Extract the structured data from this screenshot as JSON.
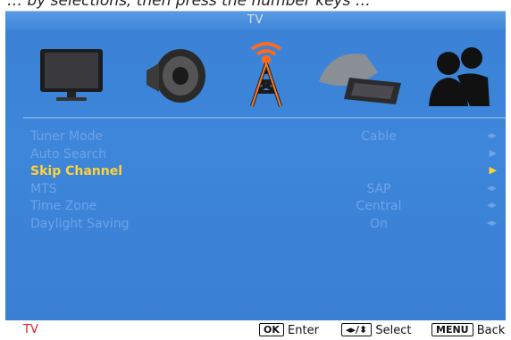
{
  "screen_title": "TV",
  "top_cropped_text": "… by selections, then press the number keys …",
  "tabs": [
    {
      "id": "picture",
      "icon": "tv-monitor-icon"
    },
    {
      "id": "sound",
      "icon": "speaker-icon"
    },
    {
      "id": "tv",
      "icon": "antenna-tower-icon"
    },
    {
      "id": "setup",
      "icon": "satellite-dish-icon"
    },
    {
      "id": "lock",
      "icon": "people-icon"
    }
  ],
  "menu": [
    {
      "label": "Tuner Mode",
      "value": "Cable",
      "arrow": "◂▸"
    },
    {
      "label": "Auto Search",
      "value": "",
      "arrow": "▶"
    },
    {
      "label": "Skip Channel",
      "value": "",
      "arrow": "▶"
    },
    {
      "label": "MTS",
      "value": "SAP",
      "arrow": "◂▸"
    },
    {
      "label": "Time Zone",
      "value": "Central",
      "arrow": "◂▸"
    },
    {
      "label": "Daylight Saving",
      "value": "On",
      "arrow": "◂▸"
    }
  ],
  "selected_index": 2,
  "footer": {
    "source": "TV",
    "ok_key": "OK",
    "ok_label": "Enter",
    "select_key": "◂▸/⬍",
    "select_label": "Select",
    "menu_key": "MENU",
    "menu_label": "Back"
  },
  "colors": {
    "background": "#3b82d6",
    "item": "#6ea3e8",
    "selected": "#ffd23a",
    "footer_source": "#dd2222"
  }
}
